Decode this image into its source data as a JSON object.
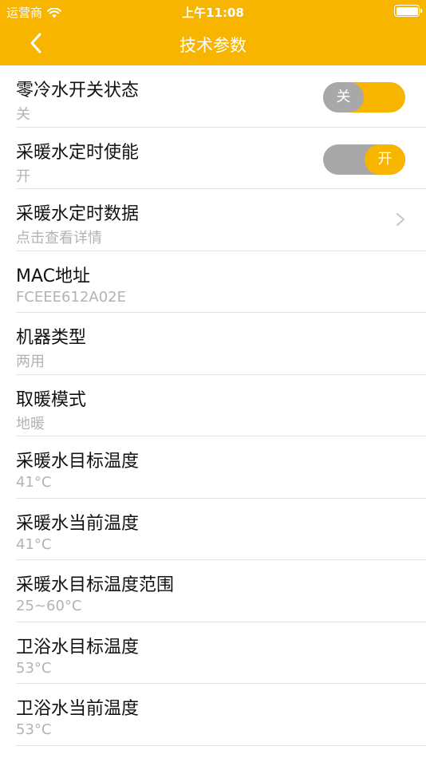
{
  "status_bar": {
    "carrier": "运营商",
    "time": "上午11:08"
  },
  "nav": {
    "title": "技术参数"
  },
  "rows": [
    {
      "label": "零冷水开关状态",
      "value": "关",
      "switch_text": "关",
      "switch_on": false
    },
    {
      "label": "采暖水定时使能",
      "value": "开",
      "switch_text": "开",
      "switch_on": true
    },
    {
      "label": "采暖水定时数据",
      "value": "点击查看详情"
    },
    {
      "label": "MAC地址",
      "value": "FCEEE612A02E"
    },
    {
      "label": "机器类型",
      "value": "两用"
    },
    {
      "label": "取暖模式",
      "value": "地暖"
    },
    {
      "label": "采暖水目标温度",
      "value": "41°C"
    },
    {
      "label": "采暖水当前温度",
      "value": "41°C"
    },
    {
      "label": "采暖水目标温度范围",
      "value": "25~60°C"
    },
    {
      "label": "卫浴水目标温度",
      "value": "53°C"
    },
    {
      "label": "卫浴水当前温度",
      "value": "53°C"
    }
  ],
  "colors": {
    "accent": "#f7b500",
    "switch_grey": "#a8a8a8",
    "secondary_text": "#b3b3b3"
  },
  "icons": {
    "back": "chevron-left-icon",
    "detail": "chevron-right-icon",
    "wifi": "wifi-icon",
    "battery": "battery-icon"
  }
}
